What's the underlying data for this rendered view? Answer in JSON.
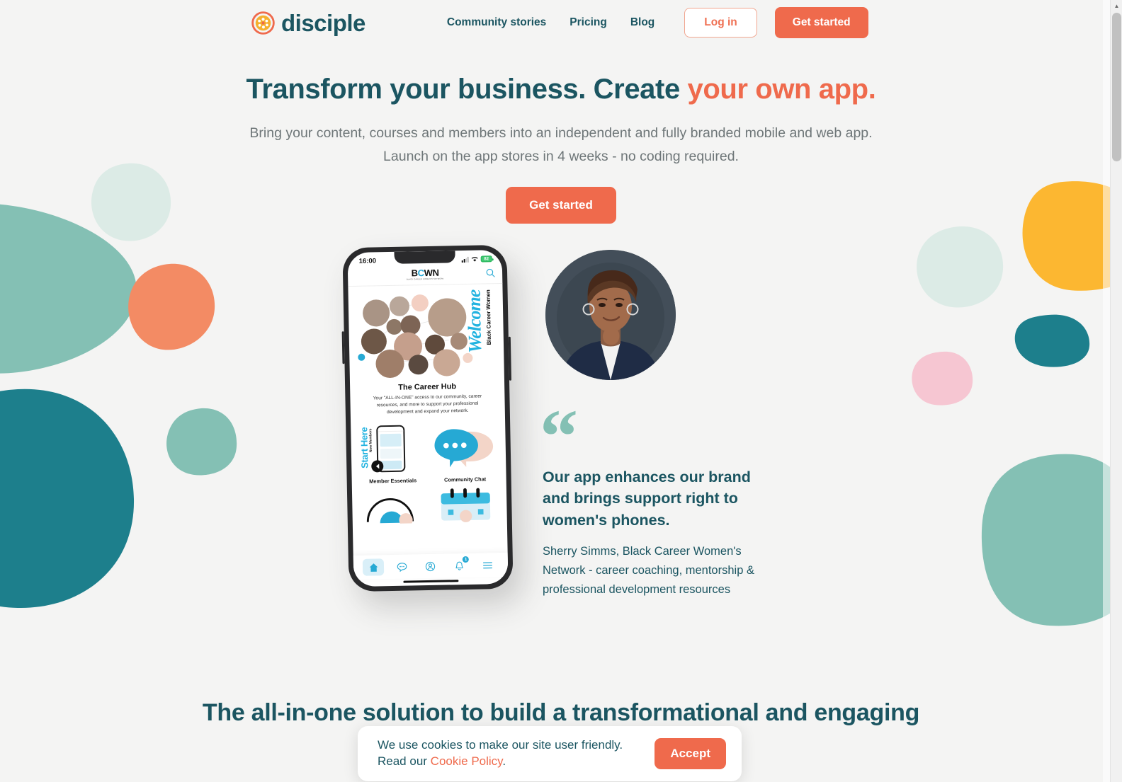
{
  "brand": {
    "name": "disciple",
    "logo_icon": "passionfruit-circle-icon",
    "colors": {
      "teal_dark": "#1b5561",
      "coral": "#ef6a4c",
      "mint": "#84c0b4",
      "teal_blob": "#1d7f8c",
      "yellow": "#fcb731",
      "pink": "#f6c6d2",
      "pale_mint": "#dcebe6",
      "page_bg": "#f4f4f3"
    }
  },
  "header": {
    "nav": [
      {
        "label": "Community stories"
      },
      {
        "label": "Pricing"
      },
      {
        "label": "Blog"
      }
    ],
    "login_label": "Log in",
    "get_started_label": "Get started"
  },
  "hero": {
    "title_part1": "Transform your business. Create ",
    "title_accent": "your own app",
    "title_period": ".",
    "subtitle_line1": "Bring your content, courses and members into an independent and fully branded mobile and web app.",
    "subtitle_line2": "Launch on the app stores in 4 weeks - no coding required.",
    "cta_label": "Get started"
  },
  "phone": {
    "status": {
      "time": "16:00",
      "battery": "82",
      "signal_icon": "signal-bars-icon",
      "wifi_icon": "wifi-icon",
      "battery_icon": "battery-icon"
    },
    "app": {
      "logo_b": "B",
      "logo_c": "C",
      "logo_wn": "WN",
      "logo_sub": "BLACK CAREER WOMEN'S NETWORK",
      "search_icon": "search-icon",
      "welcome_script": "Welcome",
      "welcome_sub": "Black Career Women",
      "hub_title": "The Career Hub",
      "hub_body": "Your \"ALL-IN-ONE\" access to our community, career resources, and more to support your professional development and expand your network.",
      "tiles": [
        {
          "label": "Member Essentials",
          "overlay_small": "New Members",
          "overlay_big": "Start Here",
          "icon": "mini-phone-icon"
        },
        {
          "label": "Community Chat",
          "icon": "chat-bubbles-icon"
        }
      ],
      "tabbar": [
        {
          "name": "home-icon",
          "active": true,
          "badge": ""
        },
        {
          "name": "chat-icon",
          "active": false,
          "badge": ""
        },
        {
          "name": "profile-icon",
          "active": false,
          "badge": ""
        },
        {
          "name": "bell-icon",
          "active": false,
          "badge": "1"
        },
        {
          "name": "menu-icon",
          "active": false,
          "badge": ""
        }
      ]
    }
  },
  "testimonial": {
    "avatar_alt": "Sherry Simms portrait",
    "quote_mark": "“",
    "quote": "Our app enhances our brand and brings support right to women's phones.",
    "author": "Sherry Simms, Black Career Women's Network - career coaching, mentorship & professional development resources"
  },
  "bottom_section": {
    "heading": "The all-in-one solution to build a transformational and engaging community"
  },
  "cookie_banner": {
    "text_before": "We use cookies to make our site user friendly. Read our ",
    "link_label": "Cookie Policy",
    "text_after": ".",
    "accept_label": "Accept"
  },
  "scrollbar": {
    "up_arrow": "▲"
  }
}
